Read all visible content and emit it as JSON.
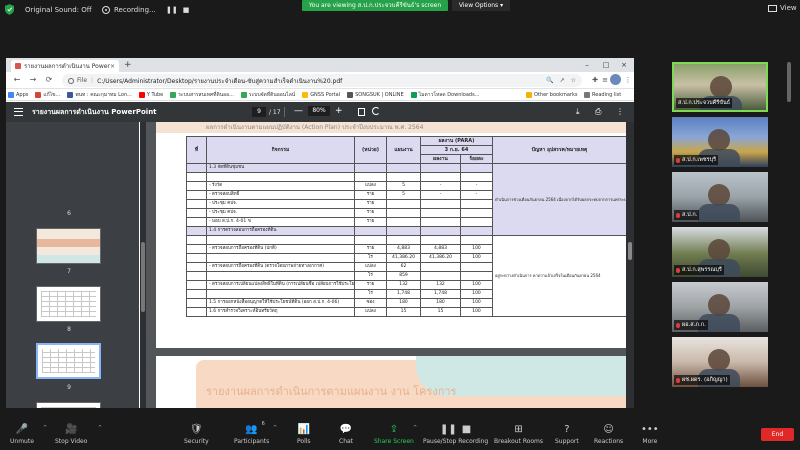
{
  "zoom_top": {
    "original_sound": "Original Sound: Off",
    "recording": "Recording...",
    "pause_icon": "❚❚",
    "stop_icon": "■",
    "viewing_banner": "You are viewing ส.ป.ก.ประจวบคีรีขันธ์'s screen",
    "view_options": "View Options ▾",
    "view": "View"
  },
  "browser": {
    "tab_title": "รายงานผลการดำเนินงาน PowerPoint",
    "tab_close": "×",
    "new_tab": "+",
    "win_min": "–",
    "win_max": "□",
    "win_close": "×",
    "nav_back": "←",
    "nav_forward": "→",
    "nav_reload": "⟳",
    "file_label": "File",
    "separator": "|",
    "url": "C:/Users/Administrator/Desktop/รายงานประจำเดือน-ขับสู่ความสำเร็จดำเนินงาน%20.pdf",
    "omni_search": "🔍",
    "omni_share": "↗",
    "omni_star": "☆",
    "ext_icon": "✚",
    "reading_list_icon": "≡",
    "menu_icon": "⋮",
    "bookmarks": [
      {
        "label": "Apps",
        "color": "#4285f4"
      },
      {
        "label": "แก้ไข...",
        "color": "#d44638"
      },
      {
        "label": "พนท : คณะกุมาทม Lon...",
        "color": "#3b5998"
      },
      {
        "label": "Y Tube",
        "color": "#ff0000"
      },
      {
        "label": "ระบบสารสนเทศที่ดินออ...",
        "color": "#34a853"
      },
      {
        "label": "ระบบจัดที่ดินออนไลน์",
        "color": "#34a853"
      },
      {
        "label": "GNSS Portal",
        "color": "#fbbc05"
      },
      {
        "label": "SONGSUK | ONLINE",
        "color": "#555555"
      },
      {
        "label": "ไมดาวโหลด Downloads...",
        "color": "#0f9d58"
      }
    ],
    "other_bookmarks": "Other bookmarks",
    "reading_list": "Reading list"
  },
  "pdf": {
    "title": "รายงานผลการดำเนินงาน PowerPoint",
    "page_current": "9",
    "page_total": "/ 17",
    "zoom_out": "—",
    "zoom_in": "+",
    "zoom": "80%",
    "download_icon": "⤓",
    "print_icon": "⎙",
    "more_icon": "⋮",
    "thumbnails": [
      "6",
      "7",
      "8",
      "9",
      "10"
    ],
    "band_text": "ผลการดำเนินงานตามแผนปฏิบัติงาน (Action Plan) ประจำปีงบประมาณ พ.ศ. 2564",
    "page2_title": "รายงานผลการดำเนินการตามแผนงาน งาน โครงการ"
  },
  "table": {
    "h_no": "ที่",
    "h_activity": "กิจกรรม",
    "h_unit": "(หน่วย)",
    "h_plan": "แผนงาน",
    "h_result": "ผลงาน (PARA)",
    "h_date": "3 ก.ย. 64",
    "h_output": "ผลงาน",
    "h_percent": "ร้อยละ",
    "h_issue": "ปัญหา อุปสรรค/หมายเหตุ",
    "rows": [
      {
        "no": "",
        "activity": "1.3 จัดที่ดินชุมชน",
        "unit": "",
        "plan": "",
        "output": "",
        "percent": "",
        "issue": "",
        "shade": true
      },
      {
        "no": "",
        "activity": "",
        "unit": "",
        "plan": "",
        "output": "",
        "percent": "",
        "issue": "",
        "shade": false
      },
      {
        "no": "",
        "activity": "- รังวัด",
        "unit": "แปลง",
        "plan": "5",
        "output": "-",
        "percent": "-",
        "issue": "",
        "shade": false
      },
      {
        "no": "",
        "activity": "- ตรวจสอบสิทธิ์",
        "unit": "ราย",
        "plan": "5",
        "output": "-",
        "percent": "-",
        "issue": "",
        "shade": false
      },
      {
        "no": "",
        "activity": "- ประชุม คปจ.",
        "unit": "ราย",
        "plan": "",
        "output": "",
        "percent": "",
        "issue": "",
        "shade": false
      },
      {
        "no": "",
        "activity": "- ประชุม คปจ.",
        "unit": "ราย",
        "plan": "",
        "output": "",
        "percent": "",
        "issue": "",
        "shade": false
      },
      {
        "no": "",
        "activity": "- มอบ ส.ป.ก. 4-01 ข",
        "unit": "ราย",
        "plan": "",
        "output": "",
        "percent": "",
        "issue": "",
        "shade": false
      },
      {
        "no": "",
        "activity": "1.4 การตรวจสอบการถือครองที่ดิน",
        "unit": "",
        "plan": "",
        "output": "",
        "percent": "",
        "issue": "",
        "shade": true
      },
      {
        "no": "",
        "activity": "",
        "unit": "",
        "plan": "",
        "output": "",
        "percent": "",
        "issue": "",
        "shade": false
      },
      {
        "no": "",
        "activity": "- ตรวจสอบการถือครองที่ดิน (ปกติ)",
        "unit": "ราย",
        "plan": "4,883",
        "output": "4,883",
        "percent": "100",
        "issue": "",
        "shade": false
      },
      {
        "no": "",
        "activity": "",
        "unit": "ไร่",
        "plan": "41,386.20",
        "output": "41,386.20",
        "percent": "100",
        "issue": "",
        "shade": false
      },
      {
        "no": "",
        "activity": "- ตรวจสอบการถือครองที่ดิน (ตรวจโดยภาพถ่ายทางอากาศ)",
        "unit": "แปลง",
        "plan": "62",
        "output": "",
        "percent": "",
        "issue": "",
        "shade": false
      },
      {
        "no": "",
        "activity": "",
        "unit": "ไร่",
        "plan": "859",
        "output": "",
        "percent": "",
        "issue": "",
        "shade": false
      },
      {
        "no": "",
        "activity": "- ตรวจสอบการเปลี่ยนแปลงสิทธิในที่ดิน (การเปลี่ยนชื่อ เปลี่ยนการใช้ประโยชน์)",
        "unit": "ราย",
        "plan": "132",
        "output": "132",
        "percent": "100",
        "issue": "",
        "shade": false
      },
      {
        "no": "",
        "activity": "",
        "unit": "ไร่",
        "plan": "1,748",
        "output": "1,748",
        "percent": "100",
        "issue": "",
        "shade": false
      },
      {
        "no": "",
        "activity": "1.5 การออกหนังสืออนุญาตให้ใช้ประโยชน์ที่ดิน (ออก ส.ป.ก. 4-06)",
        "unit": "ซอง",
        "plan": "180",
        "output": "180",
        "percent": "100",
        "issue": "",
        "shade": false
      },
      {
        "no": "",
        "activity": "1.6 การสำรวจวิเคราะห์อินทรียวัตถุ",
        "unit": "แปลง",
        "plan": "15",
        "output": "15",
        "percent": "100",
        "issue": "",
        "shade": false
      }
    ],
    "note_top": "ดำเนินการช่วงเดือนกันยายน 2564 เนื่องจากได้รับผลกระทบจากการแพร่ระบาดของโรคติดเชื้อไวรัสโคโรนา 2019 (Covid-19)",
    "note_mid": "อยู่ระหว่างดำเนินการ คาดว่าแล้วเสร็จในเดือนกันยายน 2564"
  },
  "participants": [
    {
      "name": "ส.ป.ก.ประจวบคีรีขันธ์",
      "muted": false,
      "active": true
    },
    {
      "name": "ส.ป.ก.เพชรบุรี",
      "muted": true,
      "active": false
    },
    {
      "name": "ส.ป.ก.",
      "muted": true,
      "active": false
    },
    {
      "name": "ส.ป.ก.สุพรรณบุรี",
      "muted": true,
      "active": false
    },
    {
      "name": "ผอ.ส.ภ.ก.",
      "muted": true,
      "active": false
    },
    {
      "name": "ผช.ผดร. (อภิญญา)",
      "muted": true,
      "active": false
    }
  ],
  "toolbar": {
    "unmute": "Unmute",
    "stop_video": "Stop Video",
    "security": "Security",
    "participants": "Participants",
    "participants_count": "6",
    "polls": "Polls",
    "chat": "Chat",
    "share_screen": "Share Screen",
    "pause_recording": "Pause/Stop Recording",
    "breakout_rooms": "Breakout Rooms",
    "support": "Support",
    "reactions": "Reactions",
    "more": "More",
    "end": "End",
    "caret": "^",
    "mic_icon": "🎤",
    "video_icon": "🎥",
    "security_icon": "🛡",
    "participants_icon": "👥",
    "polls_icon": "📊",
    "chat_icon": "💬",
    "share_icon": "⇪",
    "pause_icon": "❚❚",
    "stop_icon": "■",
    "breakout_icon": "⊞",
    "support_icon": "?",
    "reactions_icon": "☺",
    "more_icon": "•••"
  },
  "colors": {
    "viewing_green": "#26a34a",
    "end_red": "#e02828",
    "share_green": "#26d058",
    "pdf_toolbar": "#323639",
    "table_header": "#dcdaf0"
  }
}
